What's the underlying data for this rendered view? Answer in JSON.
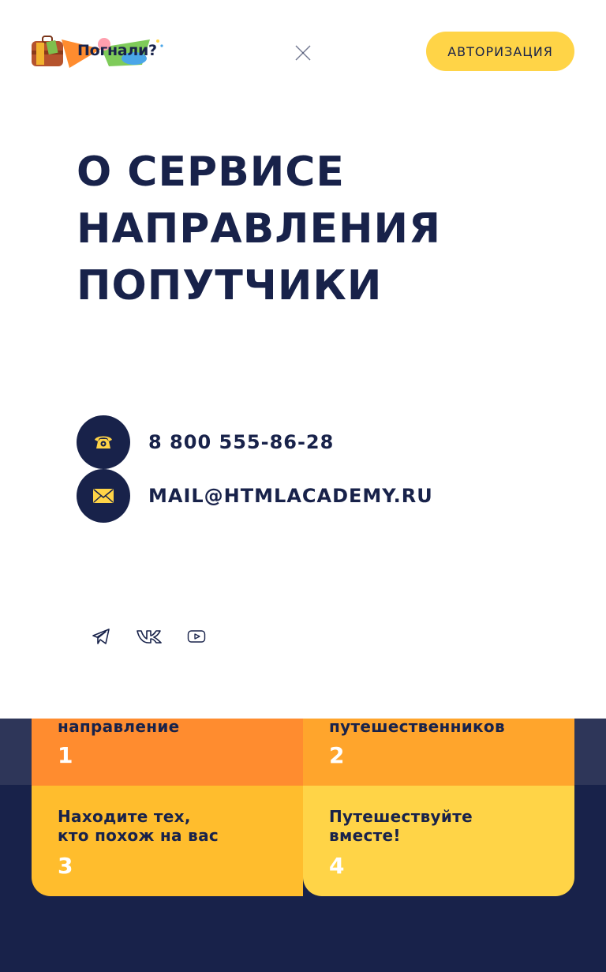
{
  "header": {
    "logo_text": "Погнали?",
    "auth_label": "АВТОРИЗАЦИЯ"
  },
  "nav": {
    "items": [
      "О СЕРВИСЕ",
      "НАПРАВЛЕНИЯ",
      "ПОПУТЧИКИ"
    ]
  },
  "contacts": {
    "phone": "8 800 555-86-28",
    "email": "MAIL@HTMLACADEMY.RU"
  },
  "social": [
    "telegram-icon",
    "vk-icon",
    "youtube-icon"
  ],
  "steps": [
    {
      "text": "направление",
      "num": "1"
    },
    {
      "text": "путешественников",
      "num": "2"
    },
    {
      "text": "Находите тех,\nкто похож на вас",
      "num": "3"
    },
    {
      "text": "Путешествуйте\nвместе!",
      "num": "4"
    }
  ],
  "colors": {
    "navy": "#18224a",
    "yellow": "#ffd447",
    "orange": "#ff8c2f"
  }
}
